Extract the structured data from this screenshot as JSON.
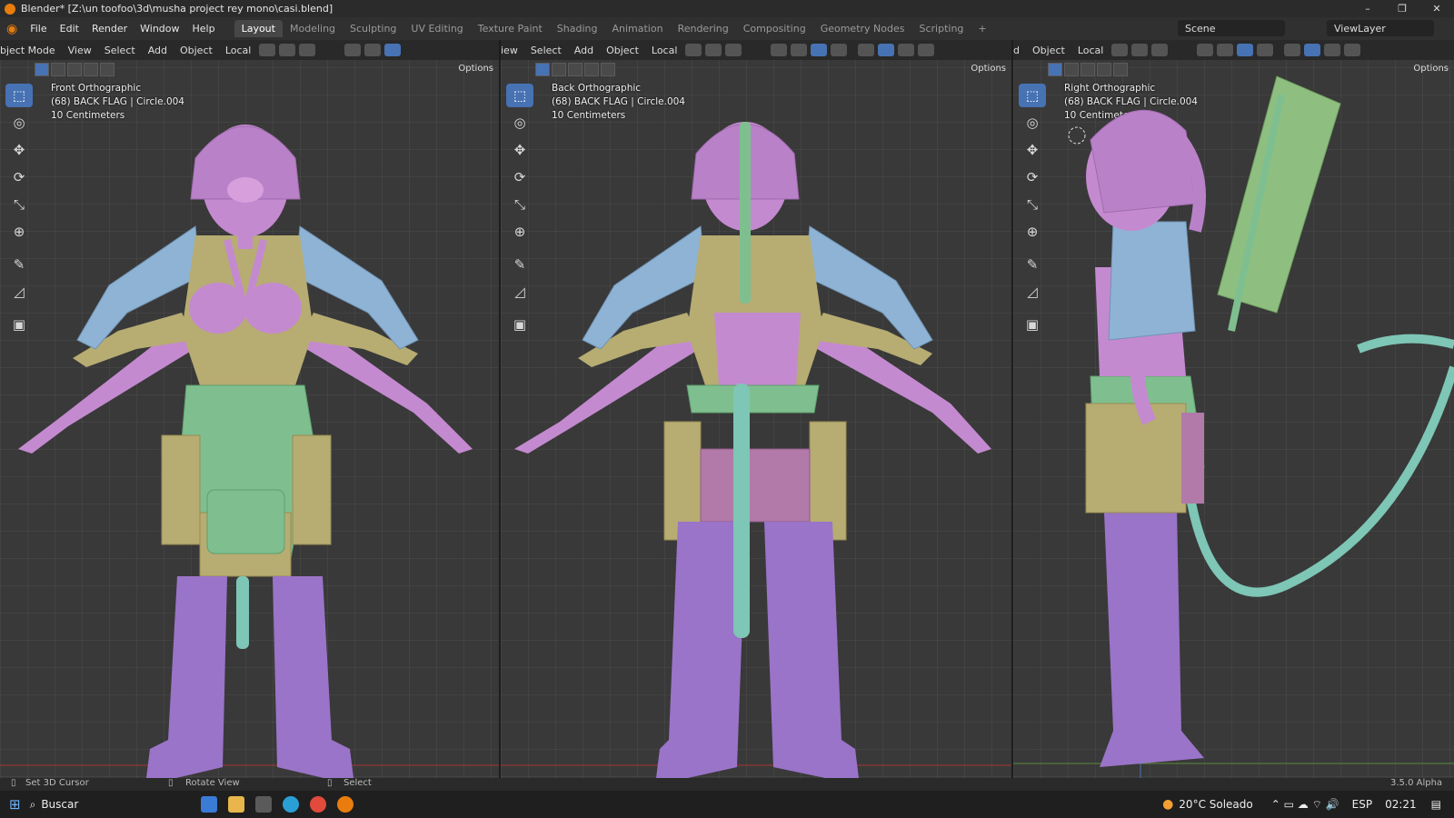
{
  "window": {
    "title": "Blender* [Z:\\un toofoo\\3d\\musha project rey mono\\casi.blend]",
    "controls": [
      "–",
      "❐",
      "✕"
    ]
  },
  "menu": {
    "items": [
      "File",
      "Edit",
      "Render",
      "Window",
      "Help"
    ],
    "workspaces": [
      "Layout",
      "Modeling",
      "Sculpting",
      "UV Editing",
      "Texture Paint",
      "Shading",
      "Animation",
      "Rendering",
      "Compositing",
      "Geometry Nodes",
      "Scripting"
    ],
    "active_workspace": "Layout",
    "add_workspace": "+",
    "scene": "Scene",
    "view_layer": "ViewLayer"
  },
  "viewports": [
    {
      "header": [
        "bject Mode",
        "View",
        "Select",
        "Add",
        "Object",
        "Local"
      ],
      "view_name": "Front Orthographic",
      "object_info": "(68) BACK FLAG | Circle.004",
      "scale": "10 Centimeters",
      "options": "Options"
    },
    {
      "header": [
        "iew",
        "Select",
        "Add",
        "Object",
        "Local"
      ],
      "view_name": "Back Orthographic",
      "object_info": "(68) BACK FLAG | Circle.004",
      "scale": "10 Centimeters",
      "options": "Options"
    },
    {
      "header": [
        "d",
        "Object",
        "Local"
      ],
      "view_name": "Right Orthographic",
      "object_info": "(68) BACK FLAG | Circle.004",
      "scale": "10 Centimeters",
      "options": "Options"
    }
  ],
  "tools": [
    "select-box-icon",
    "cursor-icon",
    "move-icon",
    "rotate-icon",
    "scale-icon",
    "transform-icon",
    "annotate-icon",
    "measure-icon",
    "add-cube-icon"
  ],
  "statusbar": {
    "hint1": "Set 3D Cursor",
    "hint2": "Rotate View",
    "hint3": "Select",
    "version": "3.5.0 Alpha"
  },
  "taskbar": {
    "search": "Buscar",
    "weather": "20°C  Soleado",
    "lang": "ESP",
    "time": "02:21"
  },
  "colors": {
    "skin": "#c48ad0",
    "armor_tan": "#b7ac72",
    "armor_blue": "#8fb3d4",
    "armor_green": "#7fbf8f",
    "rope_teal": "#7ec6b5",
    "purple": "#9a74c8",
    "accent": "#4772b3"
  }
}
